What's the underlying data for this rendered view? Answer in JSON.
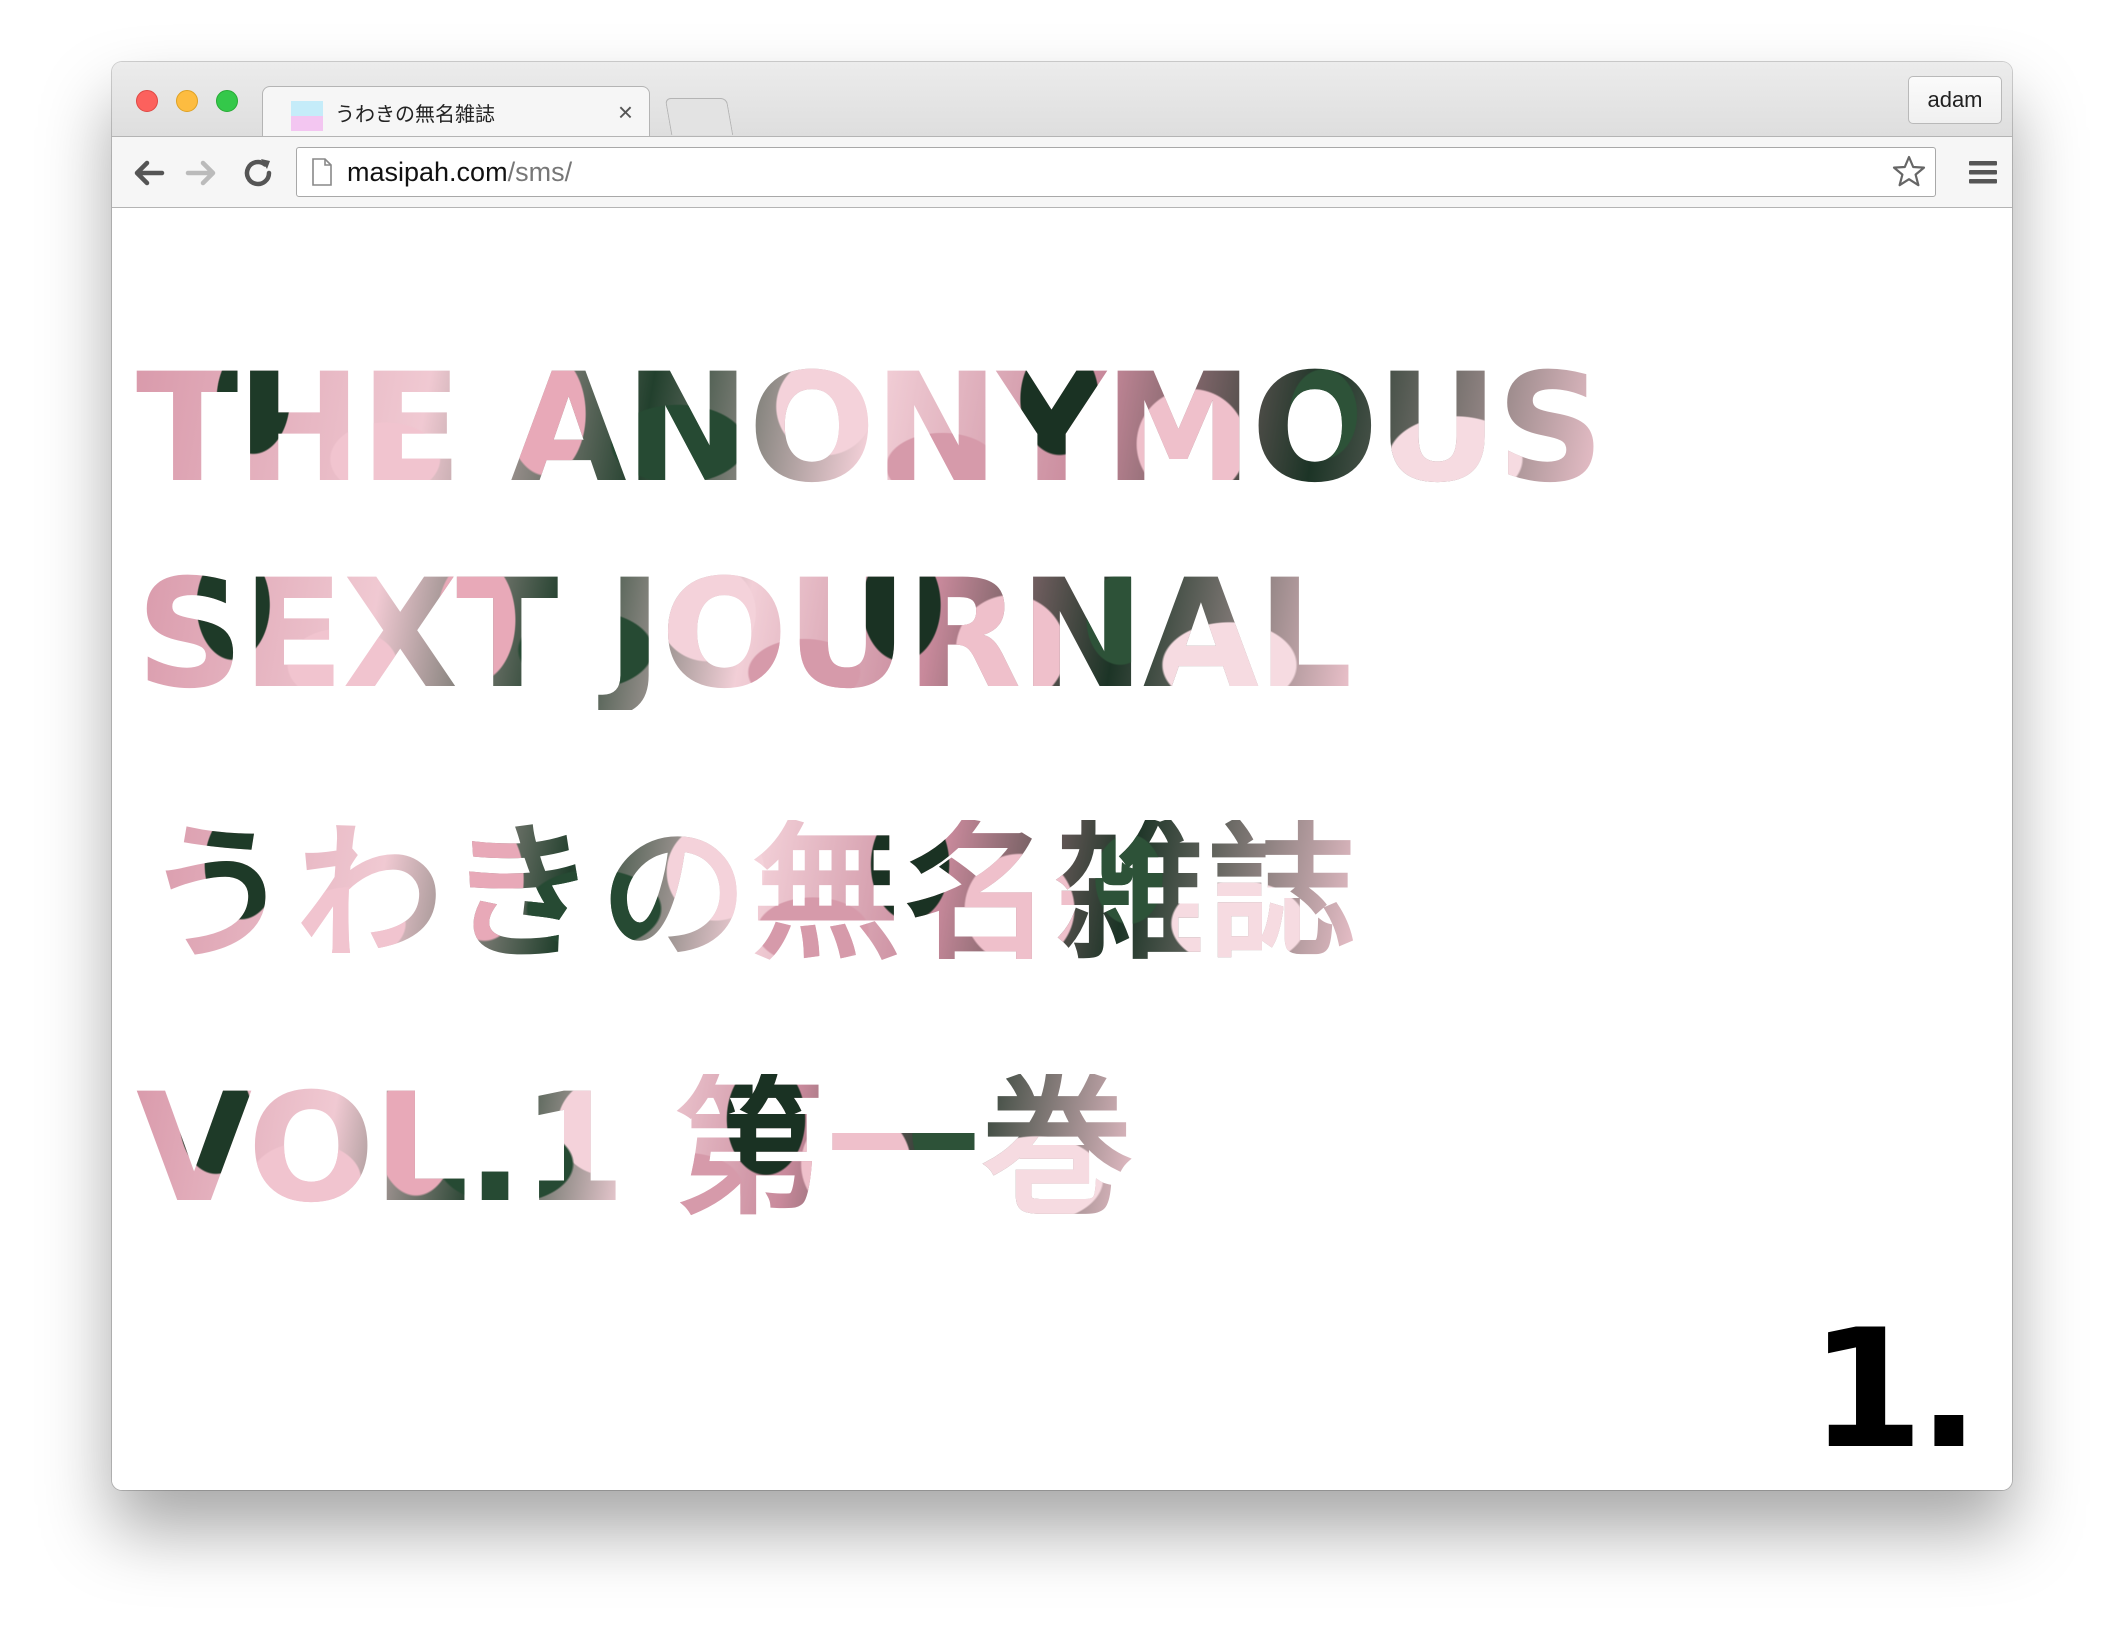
{
  "browser": {
    "tab": {
      "title": "うわきの無名雑誌",
      "close_glyph": "×"
    },
    "profile_name": "adam",
    "address": {
      "host": "masipah.com",
      "path": "/sms/"
    },
    "icons": {
      "back": "back-arrow-icon",
      "forward": "forward-arrow-icon",
      "reload": "reload-icon",
      "page": "page-icon",
      "bookmark": "star-icon",
      "menu": "hamburger-menu-icon"
    }
  },
  "page": {
    "title_line1": "THE ANONYMOUS",
    "title_line2": "SEXT JOURNAL",
    "title_line3": "うわきの無名雑誌",
    "title_line4_en": "VOL.1",
    "title_line4_jp": "第一巻",
    "issue_number": "1."
  }
}
